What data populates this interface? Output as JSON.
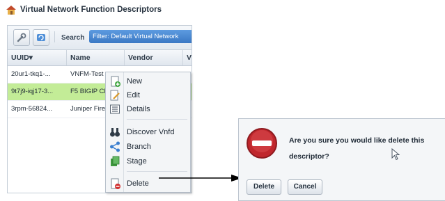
{
  "title": "Virtual Network Function Descriptors",
  "toolbar": {
    "search_label": "Search",
    "filter_text": "Filter: Default Virtual Network"
  },
  "grid": {
    "columns": [
      "UUID▾",
      "Name",
      "Vendor",
      "V"
    ],
    "rows": [
      {
        "uuid": "20ur1-tkq1-...",
        "name": "VNFM-Test",
        "vendor": "",
        "selected": false
      },
      {
        "uuid": "9t7j9-iqj17-3...",
        "name": "F5 BIGIP Cl",
        "vendor": "",
        "selected": true
      },
      {
        "uuid": "3rpm-56824...",
        "name": "Juniper Fire",
        "vendor": "",
        "selected": false
      }
    ]
  },
  "context_menu": {
    "new": "New",
    "edit": "Edit",
    "details": "Details",
    "discover": "Discover Vnfd",
    "branch": "Branch",
    "stage": "Stage",
    "delete": "Delete"
  },
  "dialog": {
    "message": "Are you sure you would like delete this descriptor?",
    "delete_label": "Delete",
    "cancel_label": "Cancel"
  },
  "colors": {
    "selected_row": "#c3ec97",
    "filter_bg": "#4a88d2",
    "stop_icon": "#c0272d"
  }
}
